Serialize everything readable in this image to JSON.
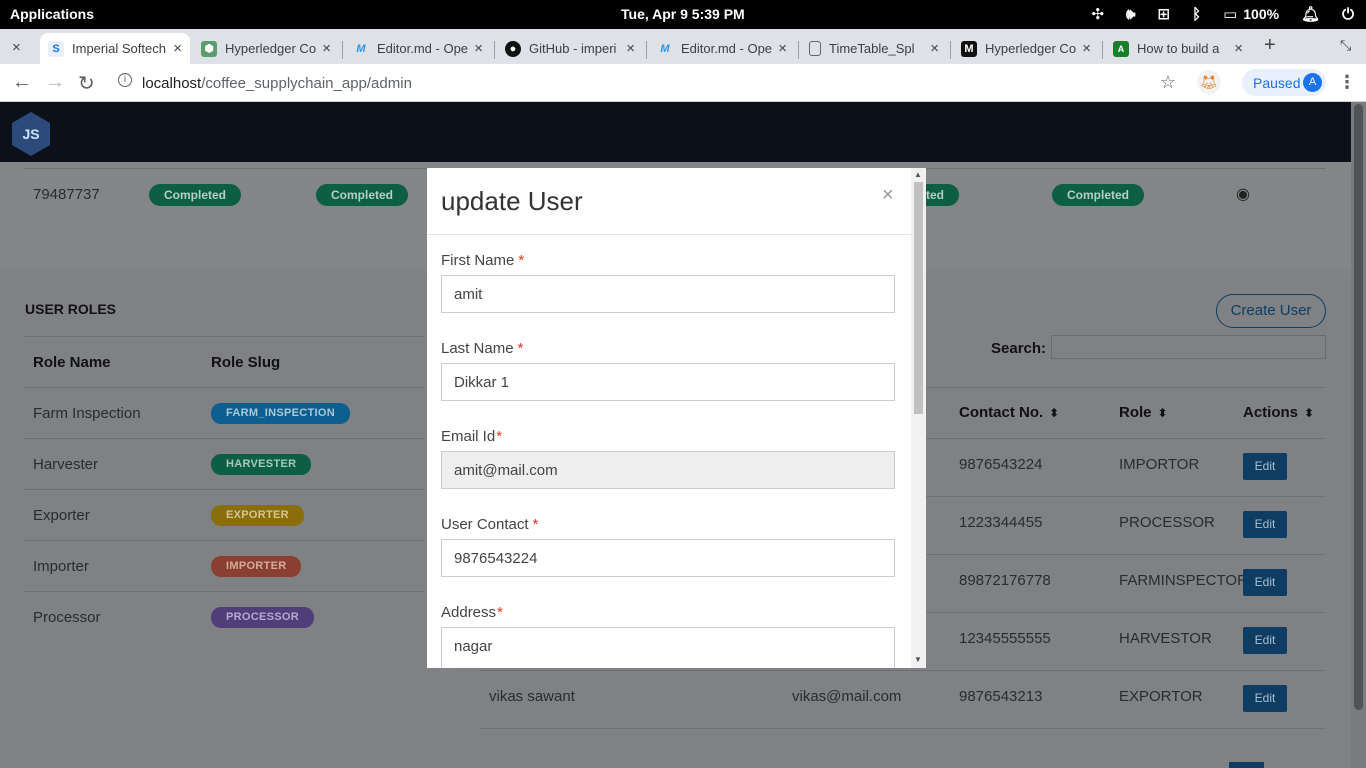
{
  "system": {
    "apps_label": "Applications",
    "clock": "Tue, Apr 9    5:39 PM",
    "battery": "100%",
    "icons": [
      "slack-icon",
      "volume-icon",
      "network-icon",
      "bluetooth-icon",
      "battery-icon",
      "bell-icon",
      "power-icon"
    ]
  },
  "browser": {
    "tabs": [
      {
        "title": "Imperial Softech",
        "favicon": "imperial-favicon",
        "active": true
      },
      {
        "title": "Hyperledger Co",
        "favicon": "hyperledger-favicon"
      },
      {
        "title": "Editor.md - Ope",
        "favicon": "editor-favicon"
      },
      {
        "title": "GitHub - imperi",
        "favicon": "github-favicon"
      },
      {
        "title": "Editor.md - Ope",
        "favicon": "editor-favicon"
      },
      {
        "title": "TimeTable_Spl",
        "favicon": "document-favicon"
      },
      {
        "title": "Hyperledger Co",
        "favicon": "medium-favicon"
      },
      {
        "title": "How to build a",
        "favicon": "build-favicon"
      }
    ],
    "url_host": "localhost",
    "url_path": "/coffee_supplychain_app/admin",
    "profile_label": "Paused",
    "profile_initial": "A"
  },
  "background": {
    "batch_id": "79487737",
    "status_label": "Completed",
    "user_roles_title": "USER ROLES",
    "role_columns": [
      "Role Name",
      "Role Slug"
    ],
    "roles": [
      {
        "name": "Farm Inspection",
        "slug": "FARM_INSPECTION",
        "color": "#0c5f8e"
      },
      {
        "name": "Harvester",
        "slug": "HARVESTER",
        "color": "#0c5f43"
      },
      {
        "name": "Exporter",
        "slug": "EXPORTER",
        "color": "#8a6e0c"
      },
      {
        "name": "Importer",
        "slug": "IMPORTER",
        "color": "#8a4030"
      },
      {
        "name": "Processor",
        "slug": "PROCESSOR",
        "color": "#4f3e7a"
      }
    ],
    "create_user_label": "Create User",
    "search_label": "Search:",
    "user_columns": {
      "contact": "Contact No.",
      "role": "Role",
      "actions": "Actions"
    },
    "users": [
      {
        "contact": "9876543224",
        "role": "IMPORTOR",
        "edit": "Edit"
      },
      {
        "contact": "1223344455",
        "role": "PROCESSOR",
        "edit": "Edit"
      },
      {
        "contact": "89872176778",
        "role": "FARMINSPECTOR",
        "edit": "Edit"
      },
      {
        "contact": "12345555555",
        "role": "HARVESTOR",
        "edit": "Edit"
      },
      {
        "name": "vikas sawant",
        "email": "vikas@mail.com",
        "contact": "9876543213",
        "role": "EXPORTOR",
        "edit": "Edit"
      }
    ]
  },
  "modal": {
    "title": "update User",
    "close_glyph": "×",
    "fields": {
      "first_name": {
        "label": "First Name",
        "value": "amit"
      },
      "last_name": {
        "label": "Last Name",
        "value": "Dikkar 1"
      },
      "email": {
        "label": "Email Id",
        "value": "amit@mail.com"
      },
      "contact": {
        "label": "User Contact",
        "value": "9876543224"
      },
      "address": {
        "label": "Address",
        "value": "nagar"
      }
    },
    "required_mark": "*"
  }
}
